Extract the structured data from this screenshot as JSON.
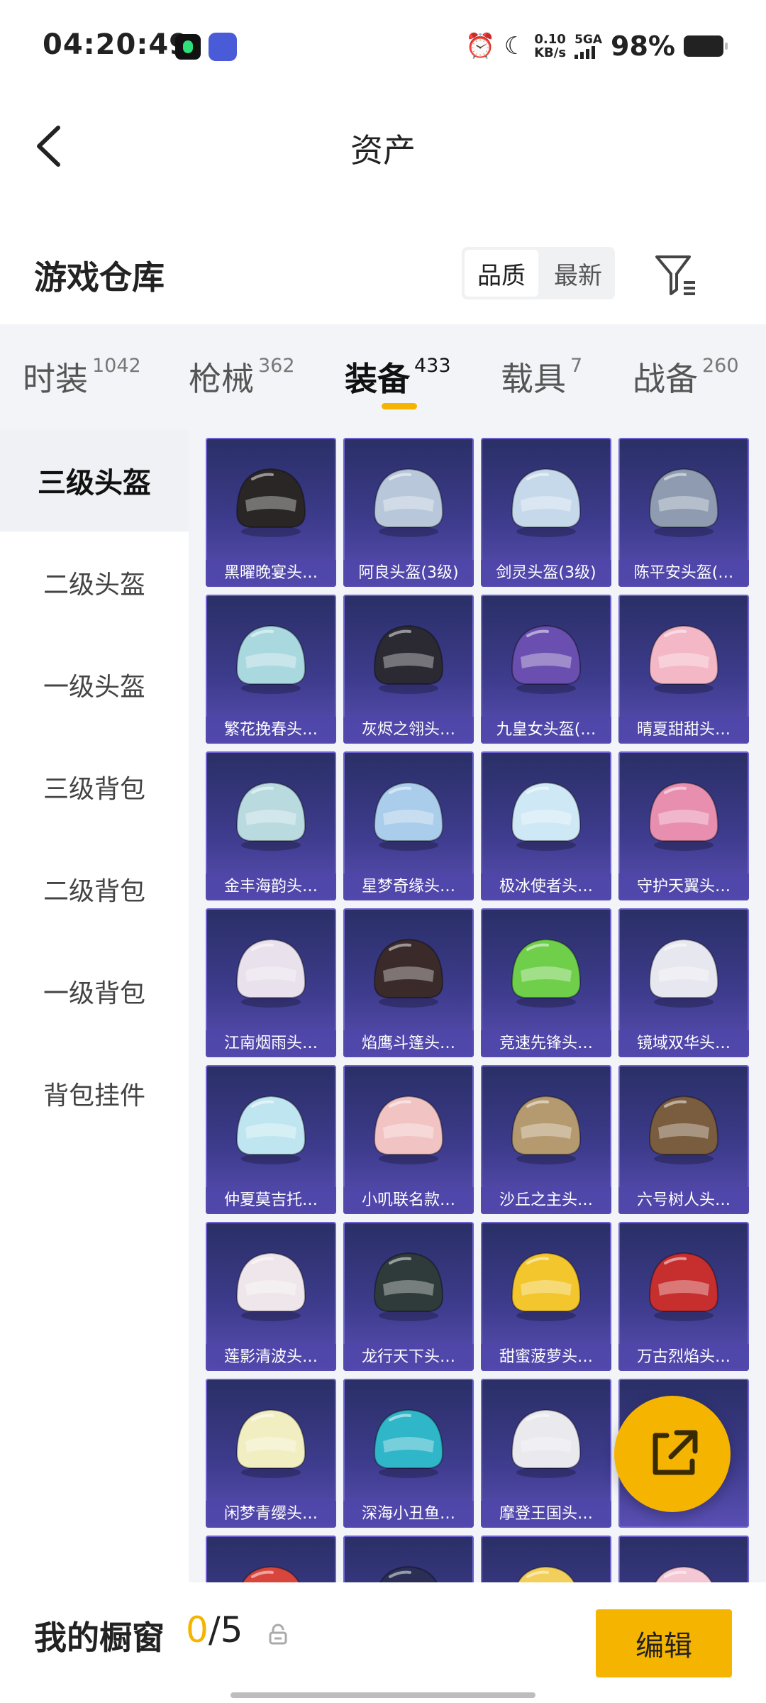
{
  "status_bar": {
    "time": "04:20:49",
    "net_speed_value": "0.10",
    "net_speed_unit": "KB/s",
    "network": "5GA",
    "battery": "98%"
  },
  "header": {
    "title": "资产"
  },
  "warehouse": {
    "title": "游戏仓库",
    "sort_options": [
      "品质",
      "最新"
    ],
    "active_sort": "品质"
  },
  "tabs": [
    {
      "label": "时装",
      "count": "1042"
    },
    {
      "label": "枪械",
      "count": "362"
    },
    {
      "label": "装备",
      "count": "433",
      "active": true
    },
    {
      "label": "载具",
      "count": "7"
    },
    {
      "label": "战备",
      "count": "260"
    }
  ],
  "sidebar": [
    {
      "label": "三级头盔",
      "active": true
    },
    {
      "label": "二级头盔"
    },
    {
      "label": "一级头盔"
    },
    {
      "label": "三级背包"
    },
    {
      "label": "二级背包"
    },
    {
      "label": "一级背包"
    },
    {
      "label": "背包挂件"
    }
  ],
  "items": [
    {
      "name": "黑曜晚宴头…",
      "color": "#2a2626"
    },
    {
      "name": "阿良头盔(3级)",
      "color": "#b9c7da"
    },
    {
      "name": "剑灵头盔(3级)",
      "color": "#c6d9ea"
    },
    {
      "name": "陈平安头盔(…",
      "color": "#8e9bb0"
    },
    {
      "name": "繁花挽春头…",
      "color": "#a9d8df"
    },
    {
      "name": "灰烬之翎头…",
      "color": "#2b2a33"
    },
    {
      "name": "九皇女头盔(…",
      "color": "#6a4fb0"
    },
    {
      "name": "晴夏甜甜头…",
      "color": "#f3b7c6"
    },
    {
      "name": "金丰海韵头…",
      "color": "#b9dbe0"
    },
    {
      "name": "星梦奇缘头…",
      "color": "#a9cdea"
    },
    {
      "name": "极冰使者头…",
      "color": "#cfe8f5"
    },
    {
      "name": "守护天翼头…",
      "color": "#e88fb0"
    },
    {
      "name": "江南烟雨头…",
      "color": "#e9e1ec"
    },
    {
      "name": "焰鹰斗篷头…",
      "color": "#3b2a2a"
    },
    {
      "name": "竞速先锋头…",
      "color": "#6fcf4a"
    },
    {
      "name": "镜域双华头…",
      "color": "#e7e7ef"
    },
    {
      "name": "仲夏莫吉托…",
      "color": "#bfe6f0"
    },
    {
      "name": "小叽联名款…",
      "color": "#f1c3c3"
    },
    {
      "name": "沙丘之主头…",
      "color": "#b69a6f"
    },
    {
      "name": "六号树人头…",
      "color": "#7a5c3e"
    },
    {
      "name": "莲影清波头…",
      "color": "#eee6ea"
    },
    {
      "name": "龙行天下头…",
      "color": "#2f3a3a"
    },
    {
      "name": "甜蜜菠萝头…",
      "color": "#f2c62c"
    },
    {
      "name": "万古烈焰头…",
      "color": "#c72e2e"
    },
    {
      "name": "闲梦青缨头…",
      "color": "#f1eec1"
    },
    {
      "name": "深海小丑鱼…",
      "color": "#2fb6c8"
    },
    {
      "name": "摩登王国头…",
      "color": "#e9e9ee"
    },
    {
      "name": "",
      "color": "#d9c2c9"
    },
    {
      "name": "",
      "color": "#d8453c"
    },
    {
      "name": "",
      "color": "#2b2f55"
    },
    {
      "name": "",
      "color": "#f1cf5a"
    },
    {
      "name": "",
      "color": "#f3c7d4"
    }
  ],
  "fab": {
    "icon": "share-external-icon"
  },
  "bottom": {
    "label": "我的橱窗",
    "current": "0",
    "total": "/5",
    "edit_label": "编辑"
  }
}
